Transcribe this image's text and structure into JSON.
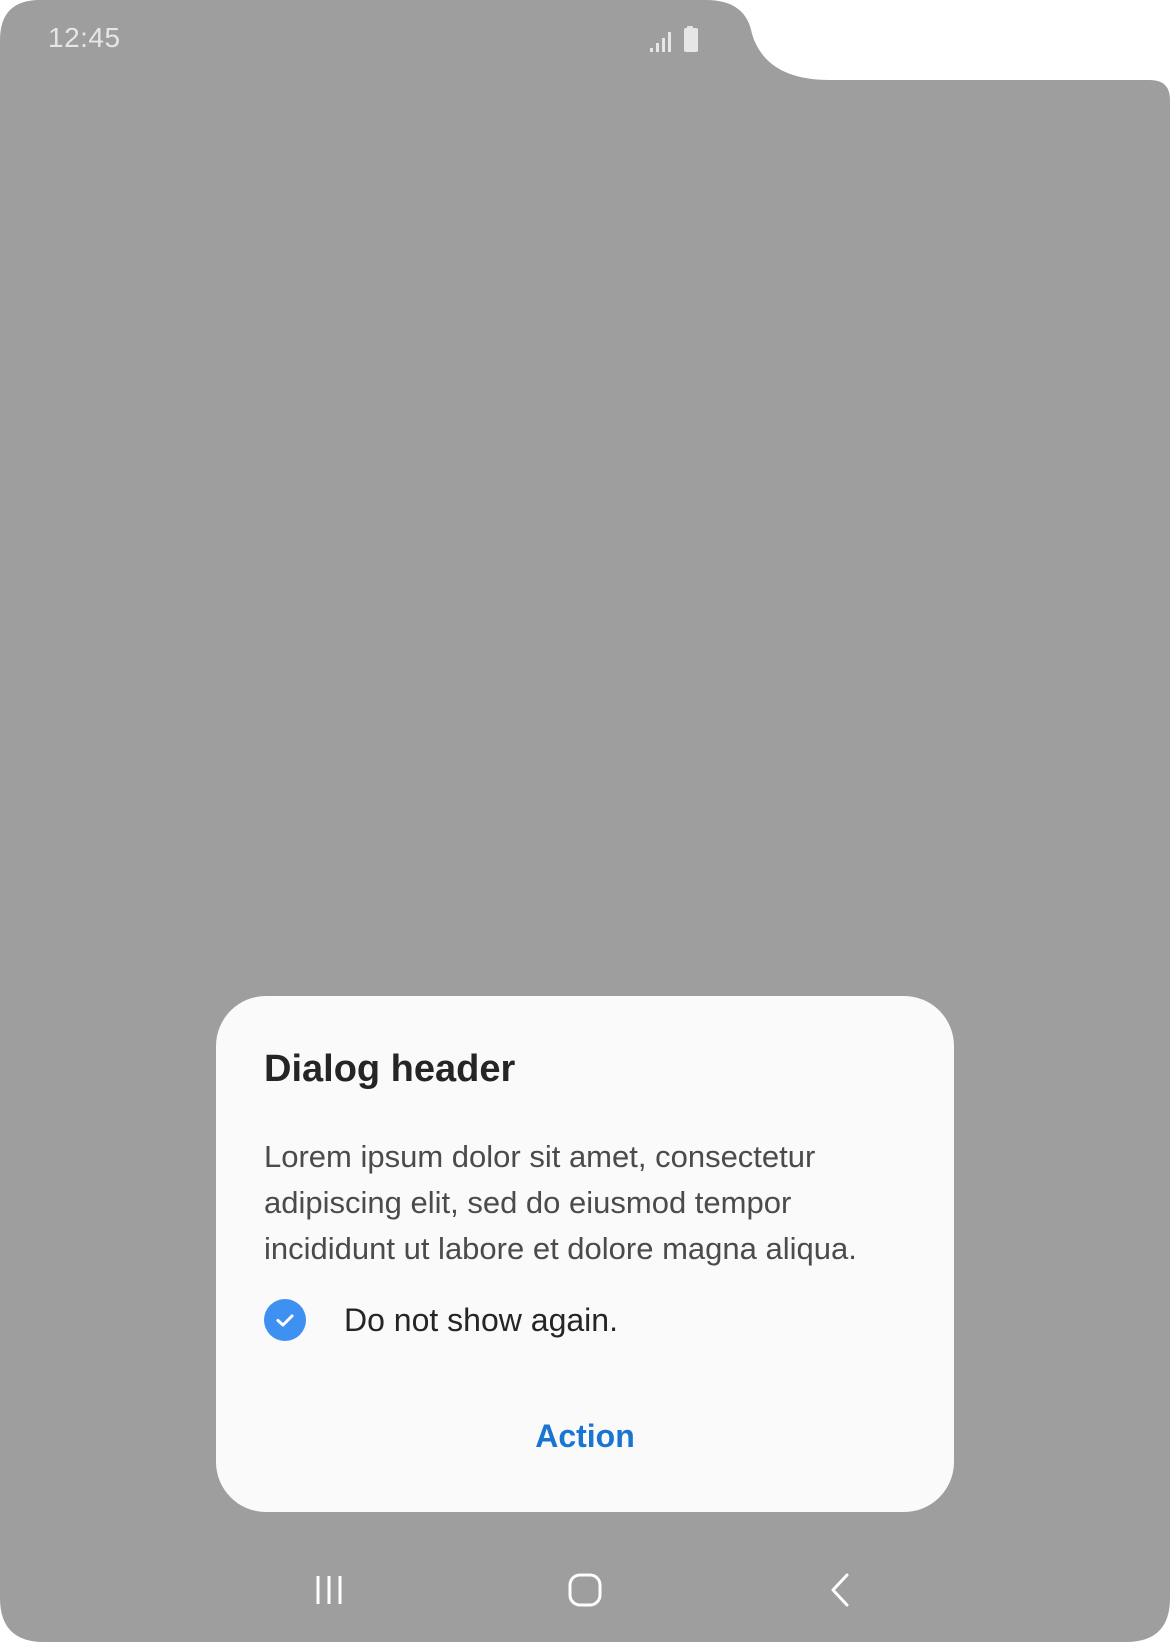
{
  "status_bar": {
    "time": "12:45",
    "icons": [
      "signal-icon",
      "battery-icon"
    ]
  },
  "dialog": {
    "title": "Dialog header",
    "body": "Lorem ipsum dolor sit amet, consectetur adipiscing elit, sed do eiusmod tempor incididunt ut labore et dolore magna aliqua.",
    "checkbox": {
      "label": "Do not show again.",
      "checked": true
    },
    "action_label": "Action"
  },
  "navigation_bar": {
    "icons": [
      "recent-apps-icon",
      "home-icon",
      "back-icon"
    ]
  },
  "colors": {
    "scrim": "#9e9e9e",
    "dialog_background": "#fafafa",
    "accent": "#1a74d2",
    "checkbox": "#3e91f0",
    "title_text": "#252525",
    "body_text": "#4b4b4b"
  }
}
